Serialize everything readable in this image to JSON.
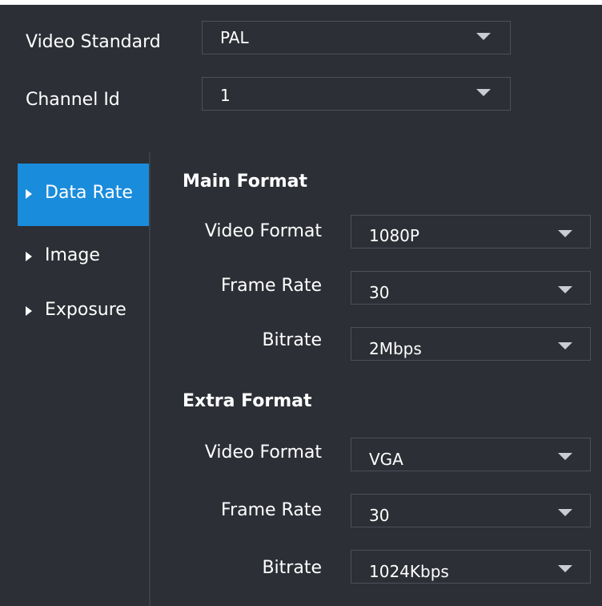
{
  "header": {
    "video_standard": {
      "label": "Video Standard",
      "value": "PAL"
    },
    "channel_id": {
      "label": "Channel Id",
      "value": "1"
    }
  },
  "sidebar": {
    "items": [
      {
        "label": "Data Rate",
        "active": true
      },
      {
        "label": "Image",
        "active": false
      },
      {
        "label": "Exposure",
        "active": false
      }
    ]
  },
  "main_format": {
    "title": "Main Format",
    "video_format": {
      "label": "Video Format",
      "value": "1080P"
    },
    "frame_rate": {
      "label": "Frame Rate",
      "value": "30"
    },
    "bitrate": {
      "label": "Bitrate",
      "value": "2Mbps"
    }
  },
  "extra_format": {
    "title": "Extra Format",
    "video_format": {
      "label": "Video Format",
      "value": "VGA"
    },
    "frame_rate": {
      "label": "Frame Rate",
      "value": "30"
    },
    "bitrate": {
      "label": "Bitrate",
      "value": "1024Kbps"
    }
  },
  "colors": {
    "background": "#2c2f35",
    "accent": "#1a8cdc",
    "border": "#4d5059"
  },
  "icons": {
    "dropdown": "triangle-down",
    "sidebar_bullet": "triangle-right"
  }
}
